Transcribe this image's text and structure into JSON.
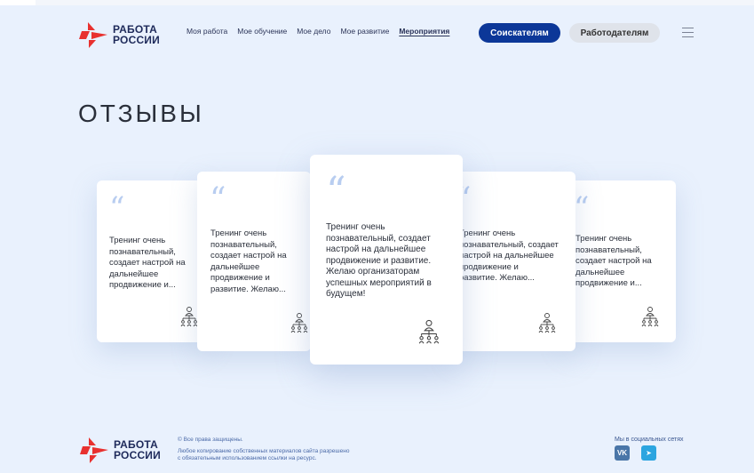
{
  "header": {
    "logo_line1": "РАБОТА",
    "logo_line2": "РОССИИ",
    "nav": [
      "Моя работа",
      "Мое обучение",
      "Мое дело",
      "Мое развитие",
      "Мероприятия"
    ],
    "active_nav": "Мероприятия",
    "btn_seekers": "Соискателям",
    "btn_employers": "Работодателям"
  },
  "page": {
    "title": "ОТЗЫВЫ"
  },
  "reviews": [
    {
      "text": "Тренинг очень познавательный, создает настрой на дальнейшее продвижение и..."
    },
    {
      "text": "Тренинг очень познавательный, создает настрой на дальнейшее продвижение и развитие. Желаю..."
    },
    {
      "text": "Тренинг очень познавательный, создает настрой на дальнейшее продвижение и развитие. Желаю организаторам успешных мероприятий в будущем!"
    },
    {
      "text": "Тренинг очень познавательный, создает настрой на дальнейшее продвижение и развитие. Желаю..."
    },
    {
      "text": "Тренинг очень познавательный, создает настрой на дальнейшее продвижение и..."
    }
  ],
  "footer": {
    "logo_line1": "РАБОТА",
    "logo_line2": "РОССИИ",
    "copyright": "© Все права защищены.",
    "notice_line1": "Любое копирование собственных материалов сайта разрешено",
    "notice_line2": "с обязательным использованием ссылки на ресурс.",
    "social_label": "Мы в социальных сетях",
    "vk_label": "VK",
    "tg_label": "➤"
  },
  "colors": {
    "accent": "#0c3798",
    "logo_red": "#e8312f",
    "background": "#e9f1fd"
  }
}
